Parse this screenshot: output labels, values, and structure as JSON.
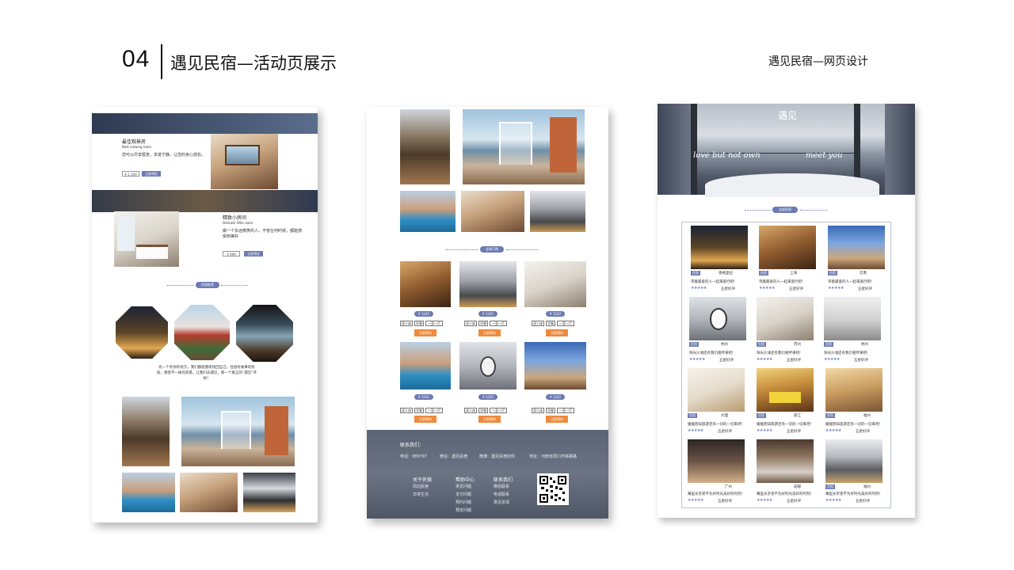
{
  "header": {
    "section_number": "04",
    "title": "遇见民宿—活动页展示",
    "right_title": "遇见民宿—网页设计"
  },
  "page1": {
    "feature1_title": "最佳观景房",
    "feature1_subtitle": "Best viewing room",
    "feature1_desc": "您可以尽享惬意，享受宁静，让您的身心放松。",
    "feature1_price": "¥ 1 399",
    "feature1_button": "立即预定",
    "feature2_title": "精致小房间",
    "feature2_subtitle": "Delicate little room",
    "feature2_desc": "做一个永远微笑的人，不管在何时候，都能感受到美好",
    "feature2_price": "¥ 999",
    "feature2_button": "立即预定",
    "section_pill": "民宿推荐",
    "paragraph": "有一个有你的地方，我们都能重新找回自己。住进有故事的民宿，感受不一样的风景。让我们去遇见，那一个真正的“遇见”开始！"
  },
  "page2": {
    "section_pill": "全球订购",
    "price": "¥ 1242",
    "tag_a": "双人床",
    "tag_b": "早餐",
    "tag_c": "一室一厅",
    "cta": "立即预约",
    "footer": {
      "contact_heading": "联系我们：",
      "phone": "电话：089797",
      "wechat": "微信：遇见民宿",
      "weibo": "微博：遇见民宿的你",
      "address": "地址：河南省周口市铁路路",
      "col1_title": "关于民宿",
      "col1_items": [
        "周边民宿",
        "日常生活"
      ],
      "col2_title": "帮助中心",
      "col2_items": [
        "常见问题",
        "支付问题",
        "预约问题",
        "预定问题"
      ],
      "col3_title": "联系我们",
      "col3_items": [
        "微信联系",
        "电话联系",
        "意见反馈"
      ]
    }
  },
  "page3": {
    "hero_title": "遇见",
    "hero_left": "love but not own",
    "hero_right": "meet you",
    "section_pill": "全部民宿",
    "rating": "五星好评",
    "cells": [
      {
        "label": "民宿",
        "city": "香格里拉",
        "desc": "带着最爱的人一起来旅行吧!"
      },
      {
        "label": "民宿",
        "city": "上海",
        "desc": "带着最爱的人一起来旅行吧!"
      },
      {
        "label": "民宿",
        "city": "云南",
        "desc": "带着最爱的人一起来旅行吧!"
      },
      {
        "label": "民宿",
        "city": "杭州",
        "desc": "阳光沙滩还有我们相伴来吧!"
      },
      {
        "label": "民宿",
        "city": "苏州",
        "desc": "阳光沙滩还有我们相伴来吧!"
      },
      {
        "label": "民宿",
        "city": "杭州",
        "desc": "阳光沙滩还有我们相伴来吧!"
      },
      {
        "label": "民宿",
        "city": "大理",
        "desc": "缓缓而知旅游还有一切的一切来吧!"
      },
      {
        "label": "民宿",
        "city": "丽江",
        "desc": "缓缓而知旅游还有一切的一切来吧!"
      },
      {
        "label": "民宿",
        "city": "福州",
        "desc": "缓缓而知旅游还有一切的一切来吧!"
      },
      {
        "label": "民宿",
        "city": "广州",
        "desc": "嘴里光享受不负好时光美好的时刻!"
      },
      {
        "label": "民宿",
        "city": "成都",
        "desc": "嘴里光享受不负好时光美好的时刻!"
      },
      {
        "label": "民宿",
        "city": "福州",
        "desc": "嘴里光享受不负好时光美好的时刻!"
      }
    ]
  }
}
